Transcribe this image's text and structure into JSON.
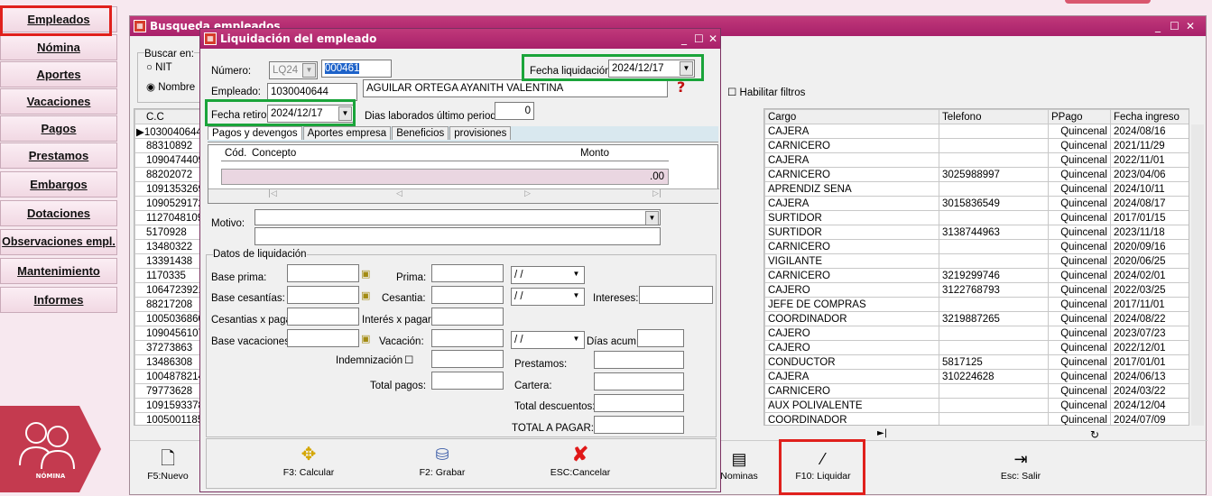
{
  "menu": {
    "items": [
      "Empleados",
      "Nómina",
      "Aportes",
      "Vacaciones",
      "Pagos",
      "Prestamos",
      "Embargos",
      "Dotaciones",
      "Observaciones empl.",
      "Mantenimiento",
      "Informes"
    ],
    "logo_text": "NÓMINA"
  },
  "bg_window": {
    "title": "Busqueda empleados",
    "search_label": "Buscar en:",
    "nit_label": "NIT",
    "nombre_label": "Nombre",
    "filter_label": "Habilitar filtros",
    "left_header": "C.C",
    "left_ids": [
      "1030040644",
      "88310892",
      "1090474409",
      "88202072",
      "1091353269",
      "1090529172",
      "1127048109",
      "5170928",
      "13480322",
      "13391438",
      "1170335",
      "1064723921",
      "88217208",
      "1005036860",
      "1090456107",
      "37273863",
      "13486308",
      "1004878214",
      "79773628",
      "1091593378",
      "1005001185"
    ],
    "right_headers": [
      "Cargo",
      "Telefono",
      "PPago",
      "Fecha ingreso"
    ],
    "rows": [
      [
        "CAJERA",
        "",
        "Quincenal",
        "2024/08/16"
      ],
      [
        "CARNICERO",
        "",
        "Quincenal",
        "2021/11/29"
      ],
      [
        "CAJERA",
        "",
        "Quincenal",
        "2022/11/01"
      ],
      [
        "CARNICERO",
        "3025988997",
        "Quincenal",
        "2023/04/06"
      ],
      [
        "APRENDIZ SENA",
        "",
        "Quincenal",
        "2024/10/11"
      ],
      [
        "CAJERA",
        "3015836549",
        "Quincenal",
        "2024/08/17"
      ],
      [
        "SURTIDOR",
        "",
        "Quincenal",
        "2017/01/15"
      ],
      [
        "SURTIDOR",
        "3138744963",
        "Quincenal",
        "2023/11/18"
      ],
      [
        "CARNICERO",
        "",
        "Quincenal",
        "2020/09/16"
      ],
      [
        "VIGILANTE",
        "",
        "Quincenal",
        "2020/06/25"
      ],
      [
        "CARNICERO",
        "3219299746",
        "Quincenal",
        "2024/02/01"
      ],
      [
        "CAJERO",
        "3122768793",
        "Quincenal",
        "2022/03/25"
      ],
      [
        "JEFE DE COMPRAS",
        "",
        "Quincenal",
        "2017/11/01"
      ],
      [
        "COORDINADOR",
        "3219887265",
        "Quincenal",
        "2024/08/22"
      ],
      [
        "CAJERO",
        "",
        "Quincenal",
        "2023/07/23"
      ],
      [
        "CAJERO",
        "",
        "Quincenal",
        "2022/12/01"
      ],
      [
        "CONDUCTOR",
        "5817125",
        "Quincenal",
        "2017/01/01"
      ],
      [
        "CAJERA",
        "310224628",
        "Quincenal",
        "2024/06/13"
      ],
      [
        "CARNICERO",
        "",
        "Quincenal",
        "2024/03/22"
      ],
      [
        "AUX POLIVALENTE",
        "",
        "Quincenal",
        "2024/12/04"
      ],
      [
        "COORDINADOR",
        "",
        "Quincenal",
        "2024/07/09"
      ]
    ],
    "footer": {
      "new": "F5:Nuevo",
      "nominas": "Nominas",
      "liquidar": "F10: Liquidar",
      "salir": "Esc: Salir"
    }
  },
  "dialog": {
    "title": "Liquidación del empleado",
    "numero_label": "Número:",
    "numero_prefix": "LQ24",
    "numero_value": "000461",
    "fecha_liq_label": "Fecha liquidación:",
    "fecha_liq_value": "2024/12/17",
    "empleado_label": "Empleado:",
    "empleado_id": "1030040644",
    "empleado_name": "AGUILAR ORTEGA AYANITH VALENTINA",
    "fecha_retiro_label": "Fecha retiro:",
    "fecha_retiro_value": "2024/12/17",
    "dias_label": "Dias laborados último periodo:",
    "dias_value": "0",
    "tabs": [
      "Pagos y devengos",
      "Aportes empresa",
      "Beneficios",
      "provisiones"
    ],
    "grid_headers": [
      "Cód.",
      "Concepto",
      "Monto"
    ],
    "grid_total": ".00",
    "motivo_label": "Motivo:",
    "datos_label": "Datos de liquidación",
    "base_prima": "Base prima:",
    "prima": "Prima:",
    "base_cesantias": "Base cesantías:",
    "cesantia": "Cesantia:",
    "intereses": "Intereses:",
    "cesantias_pagar": "Cesantias x pagar",
    "interes_pagar": "Interés x pagar:",
    "base_vacaciones": "Base vacaciones:",
    "vacacion": "Vacación:",
    "dias_acum": "Días acum:",
    "indemnizacion": "Indemnización",
    "prestamos": "Prestamos:",
    "total_pagos": "Total pagos:",
    "cartera": "Cartera:",
    "total_descuentos": "Total descuentos:",
    "total_pagar": "TOTAL A PAGAR:",
    "date_blank": " / /",
    "btn_calcular": "F3: Calcular",
    "btn_grabar": "F2: Grabar",
    "btn_cancelar": "ESC:Cancelar"
  }
}
